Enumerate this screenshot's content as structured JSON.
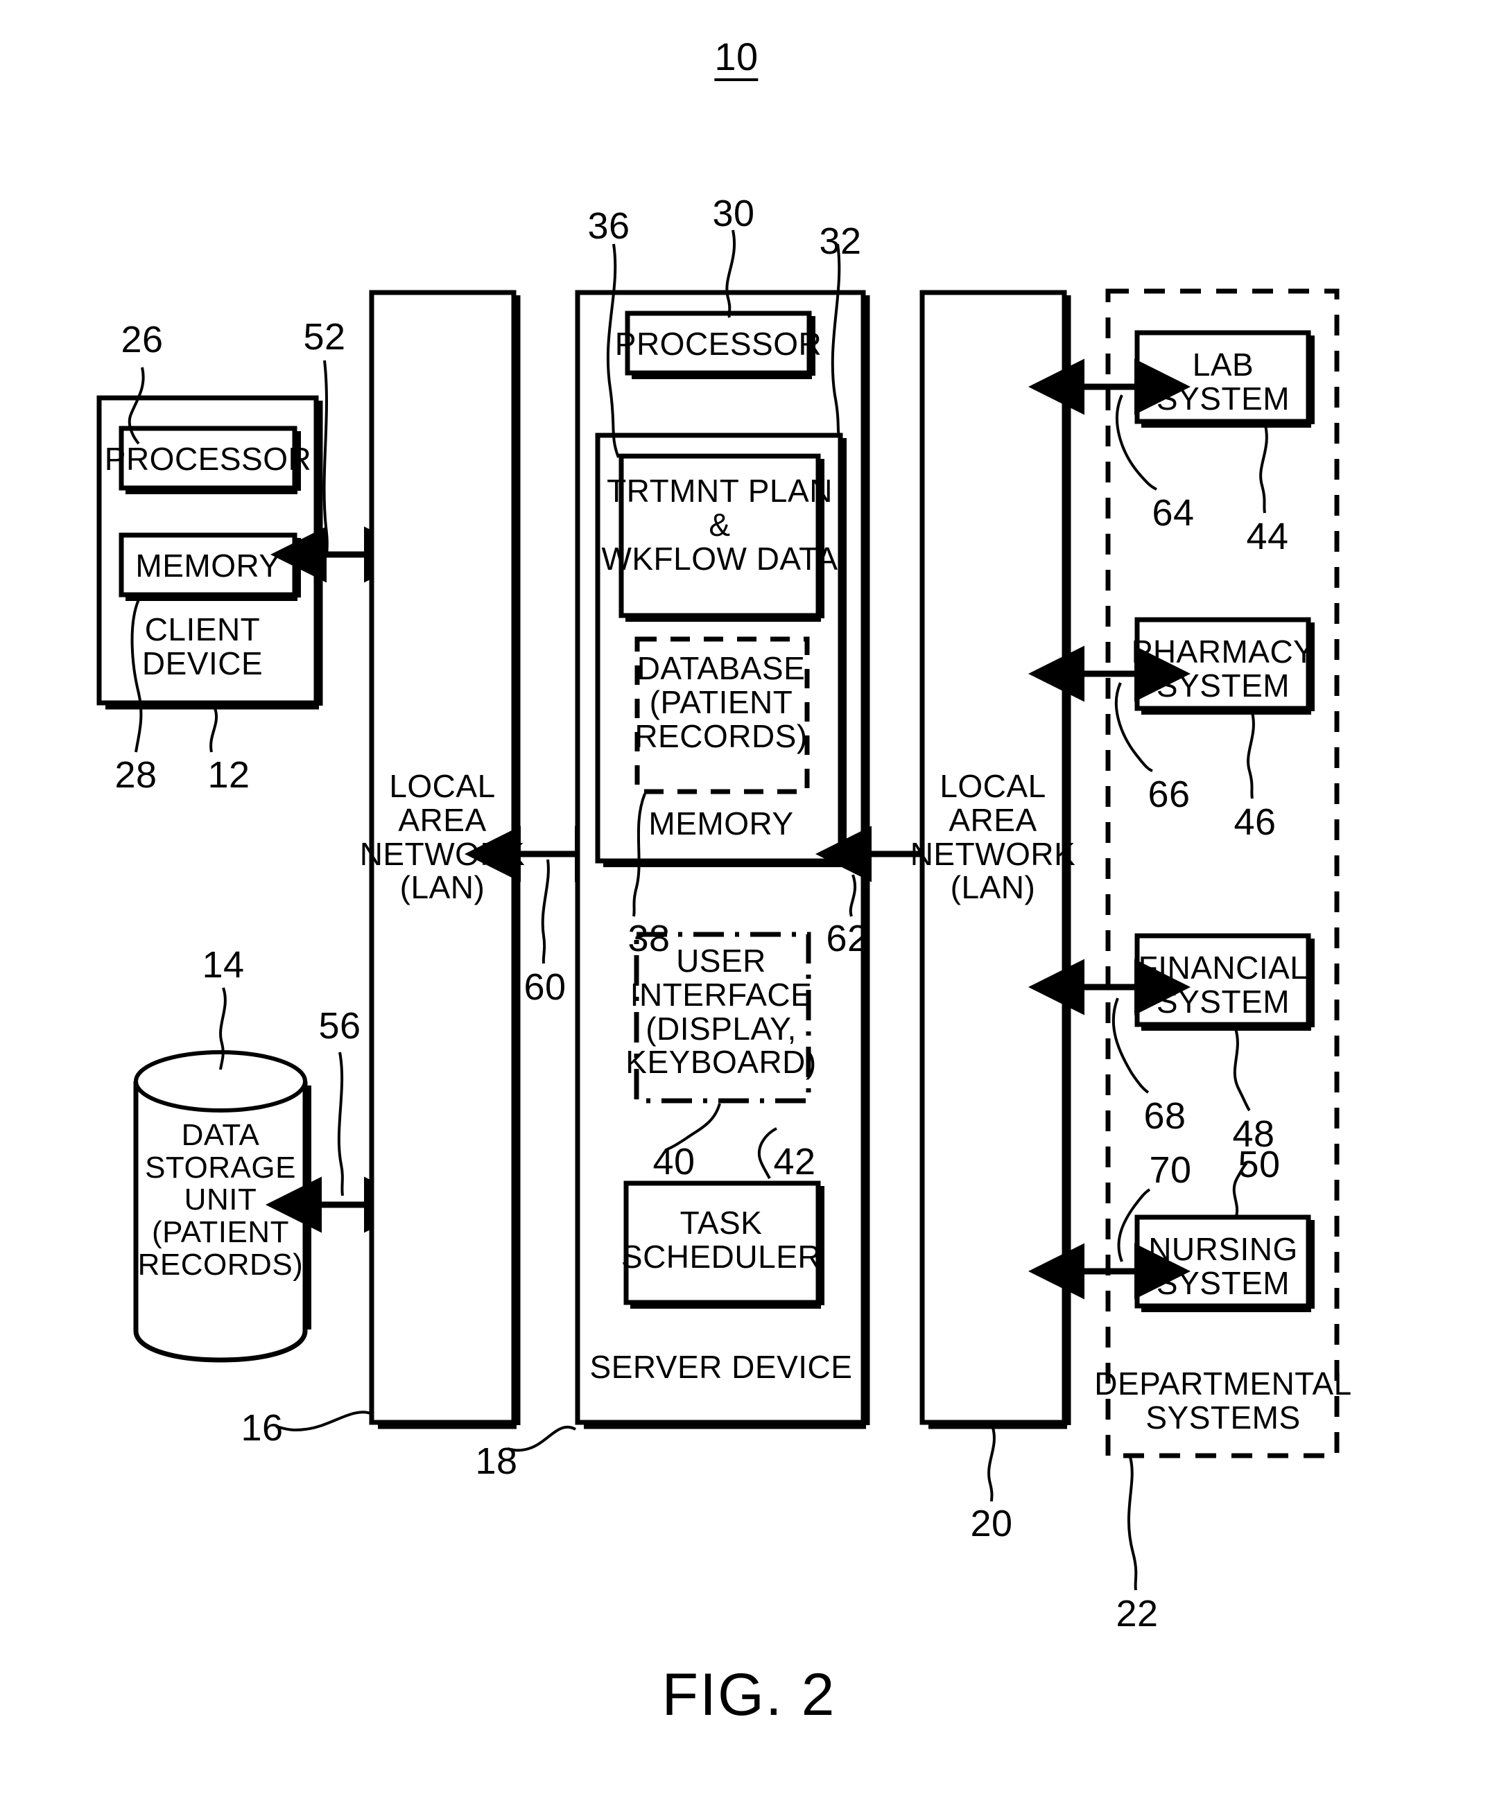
{
  "figure": {
    "number_label": "10",
    "caption": "FIG. 2"
  },
  "client_device": {
    "title": "CLIENT\nDEVICE",
    "processor_label": "PROCESSOR",
    "memory_label": "MEMORY",
    "ref_processor": "26",
    "ref_memory": "28",
    "ref_device": "12",
    "ref_link": "52"
  },
  "data_storage": {
    "label": "DATA\nSTORAGE\nUNIT\n(PATIENT\nRECORDS)",
    "ref_unit": "14",
    "ref_link": "56"
  },
  "lan_left": {
    "label": "LOCAL\nAREA\nNETWORK\n(LAN)",
    "ref": "16",
    "ref_link": "60"
  },
  "lan_right": {
    "label": "LOCAL\nAREA\nNETWORK\n(LAN)",
    "ref": "20"
  },
  "server_device": {
    "title": "SERVER DEVICE",
    "ref_device": "18",
    "processor_label": "PROCESSOR",
    "ref_processor": "30",
    "memory_label": "MEMORY",
    "ref_memory": "32",
    "treatment_plan_label": "TRTMNT PLAN\n&\nWKFLOW DATA",
    "ref_treatment_plan": "36",
    "database_label": "DATABASE\n(PATIENT\nRECORDS)",
    "ref_database": "38",
    "user_interface_label": "USER\nINTERFACE\n(DISPLAY,\nKEYBOARD)",
    "ref_user_interface": "40",
    "task_scheduler_label": "TASK\nSCHEDULER",
    "ref_task_scheduler": "42",
    "ref_link_right": "62"
  },
  "departmental": {
    "title": "DEPARTMENTAL\nSYSTEMS",
    "ref": "22",
    "systems": [
      {
        "label": "LAB\nSYSTEM",
        "ref_system": "44",
        "ref_link": "64"
      },
      {
        "label": "PHARMACY\nSYSTEM",
        "ref_system": "46",
        "ref_link": "66"
      },
      {
        "label": "FINANCIAL\nSYSTEM",
        "ref_system": "48",
        "ref_link": "68"
      },
      {
        "label": "NURSING\nSYSTEM",
        "ref_system": "50",
        "ref_link": "70"
      }
    ]
  },
  "colors": {
    "ink": "#000000",
    "paper": "#ffffff"
  }
}
